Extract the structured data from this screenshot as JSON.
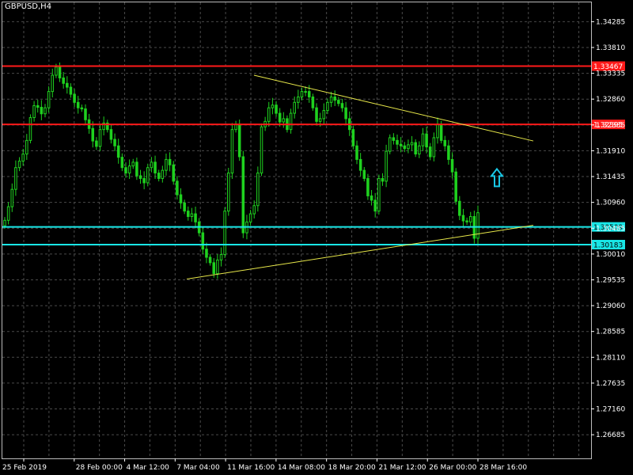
{
  "chart": {
    "symbol_label": "GBPUSD,H4"
  },
  "colors": {
    "background": "#000000",
    "grid": "#4a4a4a",
    "candle": "#1fd11f",
    "resistance": "#ff1a1a",
    "support": "#19e6e6",
    "trendline": "#e8e84a",
    "arrow": "#19c8e6",
    "axis_text": "#ffffff"
  },
  "chart_data": {
    "type": "candlestick",
    "symbol": "GBPUSD",
    "timeframe": "H4",
    "y_ticks": [
      "1.34285",
      "1.33810",
      "1.33335",
      "1.32860",
      "1.32385",
      "1.31910",
      "1.31435",
      "1.30960",
      "1.30485",
      "1.30010",
      "1.29535",
      "1.29060",
      "1.28585",
      "1.28110",
      "1.27635",
      "1.27160",
      "1.26685"
    ],
    "x_ticks": [
      "25 Feb 2019",
      "28 Feb 00:00",
      "4 Mar 12:00",
      "7 Mar 04:00",
      "11 Mar 16:00",
      "14 Mar 08:00",
      "18 Mar 20:00",
      "21 Mar 12:00",
      "26 Mar 00:00",
      "28 Mar 16:00"
    ],
    "ylim": [
      1.2625,
      1.3464
    ],
    "grid": true,
    "close_series": [
      1.3063,
      1.3088,
      1.312,
      1.316,
      1.3172,
      1.3185,
      1.321,
      1.3252,
      1.3274,
      1.3271,
      1.3259,
      1.327,
      1.33,
      1.333,
      1.3345,
      1.3325,
      1.3315,
      1.3308,
      1.3295,
      1.328,
      1.327,
      1.3268,
      1.3248,
      1.3232,
      1.3209,
      1.3199,
      1.323,
      1.3242,
      1.323,
      1.3212,
      1.32,
      1.3179,
      1.316,
      1.315,
      1.3163,
      1.317,
      1.3145,
      1.314,
      1.3132,
      1.316,
      1.317,
      1.315,
      1.314,
      1.3155,
      1.3175,
      1.3165,
      1.3135,
      1.311,
      1.3095,
      1.308,
      1.307,
      1.3075,
      1.306,
      1.304,
      1.301,
      1.2995,
      1.2985,
      1.2965,
      1.299,
      1.3,
      1.308,
      1.315,
      1.323,
      1.324,
      1.318,
      1.304,
      1.306,
      1.3075,
      1.309,
      1.315,
      1.3235,
      1.3245,
      1.327,
      1.3275,
      1.326,
      1.3244,
      1.325,
      1.323,
      1.326,
      1.328,
      1.329,
      1.33,
      1.33,
      1.329,
      1.327,
      1.3245,
      1.325,
      1.3265,
      1.328,
      1.329,
      1.3284,
      1.3278,
      1.327,
      1.325,
      1.323,
      1.32,
      1.3175,
      1.3155,
      1.314,
      1.3108,
      1.31,
      1.308,
      1.314,
      1.3135,
      1.319,
      1.3215,
      1.321,
      1.3203,
      1.32,
      1.3195,
      1.3202,
      1.3206,
      1.3185,
      1.32,
      1.3222,
      1.3198,
      1.318,
      1.3215,
      1.324,
      1.321,
      1.32,
      1.3175,
      1.3152,
      1.3098,
      1.3072,
      1.3062,
      1.306,
      1.307,
      1.303,
      1.3077
    ],
    "resistance_levels": [
      {
        "value": 1.33467,
        "label": "1.33467"
      },
      {
        "value": 1.32395,
        "label": "1.32395"
      }
    ],
    "support_levels": [
      {
        "value": 1.30509,
        "label": "1.30509"
      },
      {
        "value": 1.30183,
        "label": "1.30183"
      }
    ],
    "trendlines": [
      {
        "from": {
          "x": "7 Mar 04:00",
          "y": 1.2955
        },
        "to": {
          "x": "28 Mar 16:00",
          "y": 1.3038
        }
      },
      {
        "from": {
          "x": "11 Mar 16:00",
          "y": 1.333
        },
        "to": {
          "x": "28 Mar 16:00",
          "y": 1.3233
        }
      }
    ],
    "annotations": [
      {
        "type": "arrow-up",
        "near": "28 Mar 16:00",
        "y": 1.314
      }
    ]
  }
}
